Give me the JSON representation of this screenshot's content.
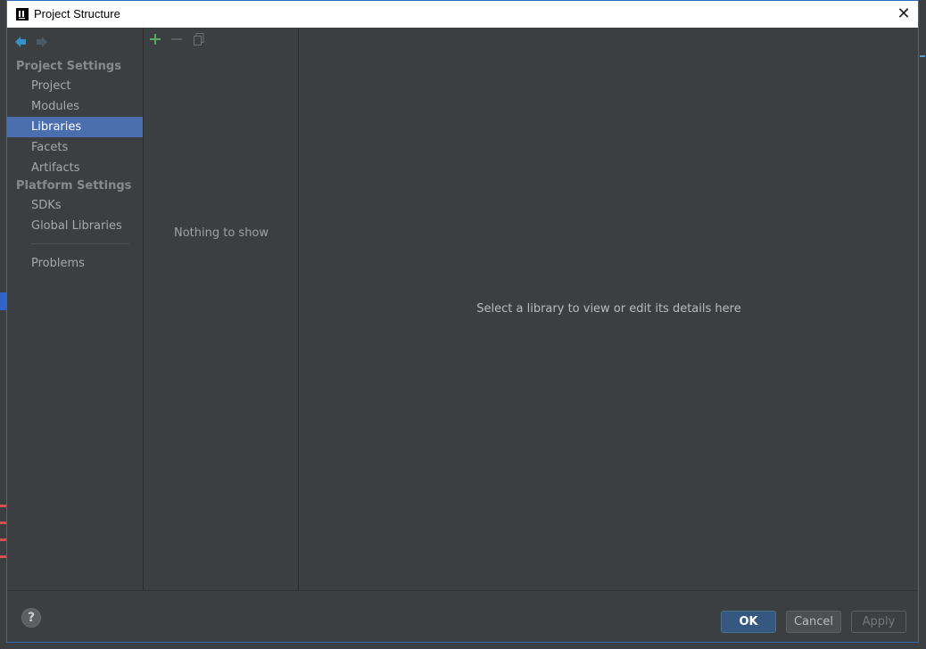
{
  "window": {
    "title": "Project Structure",
    "close_glyph": "✕"
  },
  "sidebar": {
    "project_settings_header": "Project Settings",
    "platform_settings_header": "Platform Settings",
    "items": [
      {
        "label": "Project"
      },
      {
        "label": "Modules"
      },
      {
        "label": "Libraries",
        "selected": true
      },
      {
        "label": "Facets"
      },
      {
        "label": "Artifacts"
      },
      {
        "label": "SDKs"
      },
      {
        "label": "Global Libraries"
      },
      {
        "label": "Problems"
      }
    ]
  },
  "libraries_panel": {
    "empty_text": "Nothing to show"
  },
  "details": {
    "placeholder": "Select a library to view or edit its details here"
  },
  "footer": {
    "help_glyph": "?",
    "ok_label": "OK",
    "cancel_label": "Cancel",
    "apply_label": "Apply"
  },
  "colors": {
    "selection": "#4b6eaf",
    "add_icon": "#59a869",
    "nav_back": "#3592c4",
    "ok_button": "#365880"
  }
}
